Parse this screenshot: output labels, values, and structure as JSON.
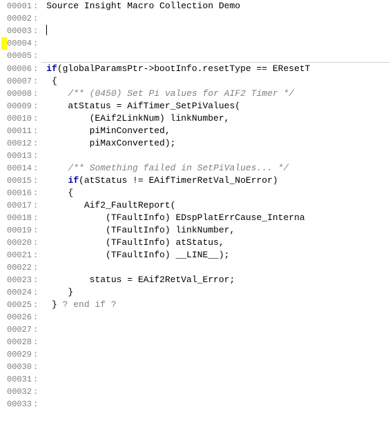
{
  "title": "Source Insight Macro Collection Demo",
  "lines": [
    {
      "n": "00001",
      "parts": [
        {
          "t": "Source Insight Macro Collection Demo",
          "c": ""
        }
      ]
    },
    {
      "n": "00002",
      "parts": []
    },
    {
      "n": "00003",
      "cursor": true,
      "parts": []
    },
    {
      "n": "00004",
      "mark": "yellow",
      "parts": []
    },
    {
      "n": "00005",
      "parts": []
    },
    {
      "n": "00006",
      "sep": true,
      "parts": [
        {
          "t": "if",
          "c": "kw"
        },
        {
          "t": "(globalParamsPtr->bootInfo.resetType == EResetT",
          "c": ""
        }
      ]
    },
    {
      "n": "00007",
      "parts": [
        {
          "t": " {",
          "c": ""
        }
      ]
    },
    {
      "n": "00008",
      "parts": [
        {
          "t": "    ",
          "c": ""
        },
        {
          "t": "/** (0450) Set Pi values for AIF2 Timer */",
          "c": "cmt"
        }
      ]
    },
    {
      "n": "00009",
      "parts": [
        {
          "t": "    atStatus = AifTimer_SetPiValues(",
          "c": ""
        }
      ]
    },
    {
      "n": "00010",
      "parts": [
        {
          "t": "        (EAif2LinkNum) linkNumber,",
          "c": ""
        }
      ]
    },
    {
      "n": "00011",
      "parts": [
        {
          "t": "        piMinConverted,",
          "c": ""
        }
      ]
    },
    {
      "n": "00012",
      "parts": [
        {
          "t": "        piMaxConverted);",
          "c": ""
        }
      ]
    },
    {
      "n": "00013",
      "parts": []
    },
    {
      "n": "00014",
      "parts": [
        {
          "t": "    ",
          "c": ""
        },
        {
          "t": "/** Something failed in SetPiValues... */",
          "c": "cmt"
        }
      ]
    },
    {
      "n": "00015",
      "parts": [
        {
          "t": "    ",
          "c": ""
        },
        {
          "t": "if",
          "c": "kw"
        },
        {
          "t": "(atStatus != EAifTimerRetVal_NoError)",
          "c": ""
        }
      ]
    },
    {
      "n": "00016",
      "parts": [
        {
          "t": "    {",
          "c": ""
        }
      ]
    },
    {
      "n": "00017",
      "parts": [
        {
          "t": "       Aif2_FaultReport(",
          "c": ""
        }
      ]
    },
    {
      "n": "00018",
      "parts": [
        {
          "t": "           (TFaultInfo) EDspPlatErrCause_Interna",
          "c": ""
        }
      ]
    },
    {
      "n": "00019",
      "parts": [
        {
          "t": "           (TFaultInfo) linkNumber,",
          "c": ""
        }
      ]
    },
    {
      "n": "00020",
      "parts": [
        {
          "t": "           (TFaultInfo) atStatus,",
          "c": ""
        }
      ]
    },
    {
      "n": "00021",
      "parts": [
        {
          "t": "           (TFaultInfo) __LINE__);",
          "c": ""
        }
      ]
    },
    {
      "n": "00022",
      "parts": []
    },
    {
      "n": "00023",
      "parts": [
        {
          "t": "        status = EAif2RetVal_Error;",
          "c": ""
        }
      ]
    },
    {
      "n": "00024",
      "parts": [
        {
          "t": "    }",
          "c": ""
        }
      ]
    },
    {
      "n": "00025",
      "parts": [
        {
          "t": " } ",
          "c": ""
        },
        {
          "t": "? end if ?",
          "c": "grey"
        }
      ]
    },
    {
      "n": "00026",
      "parts": []
    },
    {
      "n": "00027",
      "parts": []
    },
    {
      "n": "00028",
      "parts": []
    },
    {
      "n": "00029",
      "parts": []
    },
    {
      "n": "00030",
      "parts": []
    },
    {
      "n": "00031",
      "parts": []
    },
    {
      "n": "00032",
      "parts": []
    },
    {
      "n": "00033",
      "parts": []
    }
  ]
}
